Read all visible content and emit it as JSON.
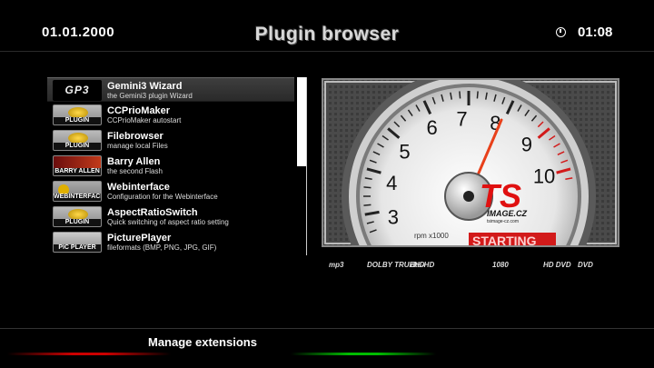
{
  "header": {
    "date": "01.01.2000",
    "title": "Plugin browser",
    "time": "01:08",
    "clock_icon": "clock-icon"
  },
  "plugins": [
    {
      "name": "Gemini3 Wizard",
      "description": "the Gemini3 plugin Wizard",
      "icon": "gp3-logo-icon",
      "icon_label": "GP3"
    },
    {
      "name": "CCPrioMaker",
      "description": "CCPrioMaker autostart",
      "icon": "plugin-icon",
      "icon_label": "PLUGIN"
    },
    {
      "name": "Filebrowser",
      "description": "manage local Files",
      "icon": "plugin-icon",
      "icon_label": "PLUGIN"
    },
    {
      "name": "Barry Allen",
      "description": "the second Flash",
      "icon": "barry-allen-icon",
      "icon_label": "BARRY ALLEN"
    },
    {
      "name": "Webinterface",
      "description": "Configuration for the Webinterface",
      "icon": "webinterface-icon",
      "icon_label": "WEBINTERFACE"
    },
    {
      "name": "AspectRatioSwitch",
      "description": "Quick switching of aspect ratio setting",
      "icon": "plugin-icon",
      "icon_label": "PLUGIN"
    },
    {
      "name": "PicturePlayer",
      "description": "fileformats (BMP, PNG, JPG, GIF)",
      "icon": "pic-player-icon",
      "icon_label": "PIC PLAYER"
    }
  ],
  "selected_index": 0,
  "scroll_fraction": 0.5,
  "preview": {
    "gauge_numbers": [
      "3",
      "4",
      "5",
      "6",
      "7",
      "8",
      "9",
      "10"
    ],
    "gauge_unit": "rpm x1000",
    "brand": "TS",
    "brand_sub": "IMAGE.CZ",
    "brand_url": "tsimage-cz.com",
    "status_text": "STARTING"
  },
  "media_logos": [
    "mp3",
    "DOLBY TRUEHD",
    "dts-HD",
    "1080",
    "HD DVD",
    "DVD"
  ],
  "footer": {
    "label": "Manage extensions"
  },
  "colors": {
    "accent_red": "#cc0000",
    "accent_green": "#00bb00",
    "selection": "#3a3a3a"
  }
}
